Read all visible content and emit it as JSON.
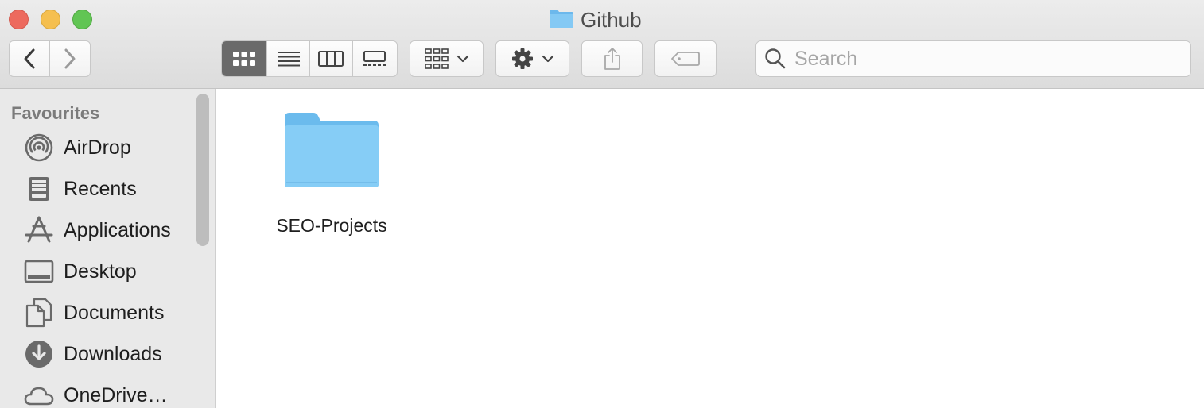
{
  "window": {
    "title": "Github"
  },
  "toolbar": {
    "back_icon": "chevron-left-icon",
    "forward_icon": "chevron-right-icon",
    "view_modes": [
      "icon-view-icon",
      "list-view-icon",
      "column-view-icon",
      "gallery-view-icon"
    ],
    "active_view": "icon-view-icon",
    "group_icon": "group-by-icon",
    "action_icon": "gear-icon",
    "share_icon": "share-icon",
    "tag_icon": "tag-icon"
  },
  "search": {
    "placeholder": "Search",
    "value": ""
  },
  "sidebar": {
    "heading": "Favourites",
    "items": [
      {
        "label": "AirDrop",
        "icon": "airdrop-icon"
      },
      {
        "label": "Recents",
        "icon": "recents-icon"
      },
      {
        "label": "Applications",
        "icon": "applications-icon"
      },
      {
        "label": "Desktop",
        "icon": "desktop-icon"
      },
      {
        "label": "Documents",
        "icon": "documents-icon"
      },
      {
        "label": "Downloads",
        "icon": "downloads-icon"
      },
      {
        "label": "OneDrive…",
        "icon": "cloud-icon"
      }
    ]
  },
  "content": {
    "items": [
      {
        "name": "SEO-Projects",
        "icon": "folder-icon"
      }
    ]
  },
  "colors": {
    "folder": "#7cc4f2",
    "close": "#ed6a5e",
    "minimize": "#f5bf4f",
    "zoom": "#61c554"
  }
}
